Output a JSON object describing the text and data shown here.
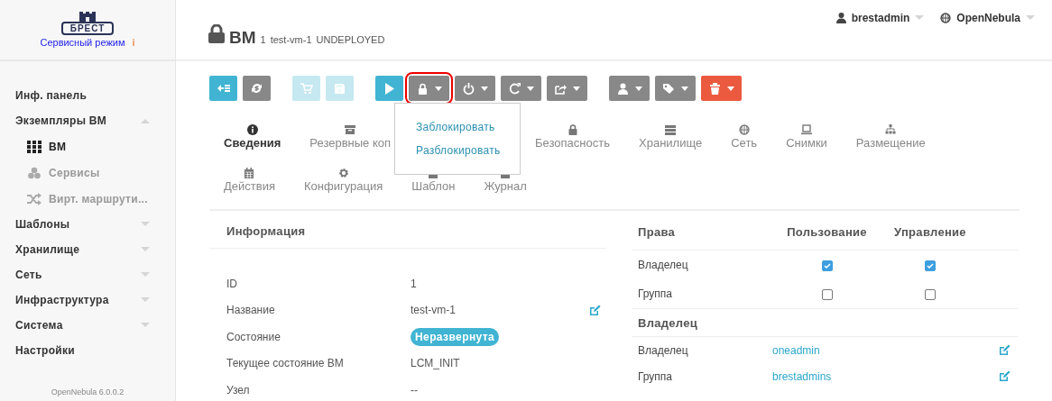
{
  "sidebar": {
    "logo_text": "БРЕСТ",
    "mode": "Сервисный режим",
    "mode_info": "i",
    "items": [
      {
        "label": "Инф. панель",
        "kind": "link"
      },
      {
        "label": "Экземпляры ВМ",
        "kind": "group",
        "expanded": true,
        "children": [
          {
            "label": "ВМ",
            "selected": true
          },
          {
            "label": "Сервисы",
            "selected": false
          },
          {
            "label": "Вирт. маршрути...",
            "selected": false
          }
        ]
      },
      {
        "label": "Шаблоны",
        "kind": "group",
        "expanded": false
      },
      {
        "label": "Хранилище",
        "kind": "group",
        "expanded": false
      },
      {
        "label": "Сеть",
        "kind": "group",
        "expanded": false
      },
      {
        "label": "Инфраструктура",
        "kind": "group",
        "expanded": false
      },
      {
        "label": "Система",
        "kind": "group",
        "expanded": false
      },
      {
        "label": "Настройки",
        "kind": "link"
      }
    ],
    "version": "OpenNebula 6.0.0.2"
  },
  "header": {
    "title": "ВМ",
    "id": "1",
    "name": "test-vm-1",
    "state": "UNDEPLOYED",
    "user": "brestadmin",
    "zone": "OpenNebula"
  },
  "toolbar_groups": [
    [
      {
        "kind": "primary",
        "disabled": false,
        "dropdown": false,
        "highlighted": false
      },
      {
        "kind": "default",
        "disabled": false,
        "dropdown": false,
        "highlighted": false
      }
    ],
    [
      {
        "kind": "primary",
        "disabled": true,
        "dropdown": false,
        "highlighted": false
      },
      {
        "kind": "primary",
        "disabled": true,
        "dropdown": false,
        "highlighted": false
      }
    ],
    [
      {
        "kind": "primary",
        "disabled": false,
        "dropdown": false,
        "highlighted": false
      },
      {
        "kind": "default",
        "disabled": false,
        "dropdown": true,
        "highlighted": true
      },
      {
        "kind": "default",
        "disabled": false,
        "dropdown": true,
        "highlighted": false
      },
      {
        "kind": "default",
        "disabled": false,
        "dropdown": true,
        "highlighted": false
      },
      {
        "kind": "default",
        "disabled": false,
        "dropdown": true,
        "highlighted": false
      }
    ],
    [
      {
        "kind": "default",
        "disabled": false,
        "dropdown": true,
        "highlighted": false
      },
      {
        "kind": "default",
        "disabled": false,
        "dropdown": true,
        "highlighted": false
      },
      {
        "kind": "danger",
        "disabled": false,
        "dropdown": true,
        "highlighted": false
      }
    ]
  ],
  "lock_menu": [
    "Заблокировать",
    "Разблокировать"
  ],
  "tab_rows": [
    [
      {
        "label": "Сведения",
        "selected": true
      },
      {
        "label": "Резервные коп",
        "selected": false
      },
      {
        "label": "Безопасность",
        "selected": false
      },
      {
        "label": "Хранилище",
        "selected": false
      },
      {
        "label": "Сеть",
        "selected": false
      },
      {
        "label": "Снимки",
        "selected": false
      },
      {
        "label": "Размещение",
        "selected": false
      }
    ],
    [
      {
        "label": "Действия",
        "selected": false
      },
      {
        "label": "Конфигурация",
        "selected": false
      },
      {
        "label": "Шаблон",
        "selected": false
      },
      {
        "label": "Журнал",
        "selected": false
      }
    ]
  ],
  "info": {
    "title": "Информация",
    "rows": [
      {
        "label": "ID",
        "value": "1",
        "kind": "text",
        "editable": false
      },
      {
        "label": "Название",
        "value": "test-vm-1",
        "kind": "text",
        "editable": true
      },
      {
        "label": "Состояние",
        "value": "Неразвернута",
        "kind": "badge",
        "editable": false
      },
      {
        "label": "Текущее состояние ВМ",
        "value": "LCM_INIT",
        "kind": "text",
        "editable": false
      },
      {
        "label": "Узел",
        "value": "--",
        "kind": "text",
        "editable": false
      }
    ]
  },
  "permissions": {
    "columns": [
      "Права",
      "Пользование",
      "Управление"
    ],
    "rows": [
      {
        "label": "Владелец",
        "use": true,
        "manage": true
      },
      {
        "label": "Группа",
        "use": false,
        "manage": false
      }
    ]
  },
  "ownership": {
    "title": "Владелец",
    "rows": [
      {
        "label": "Владелец",
        "value": "oneadmin",
        "editable": true
      },
      {
        "label": "Группа",
        "value": "brestadmins",
        "editable": true
      }
    ]
  }
}
